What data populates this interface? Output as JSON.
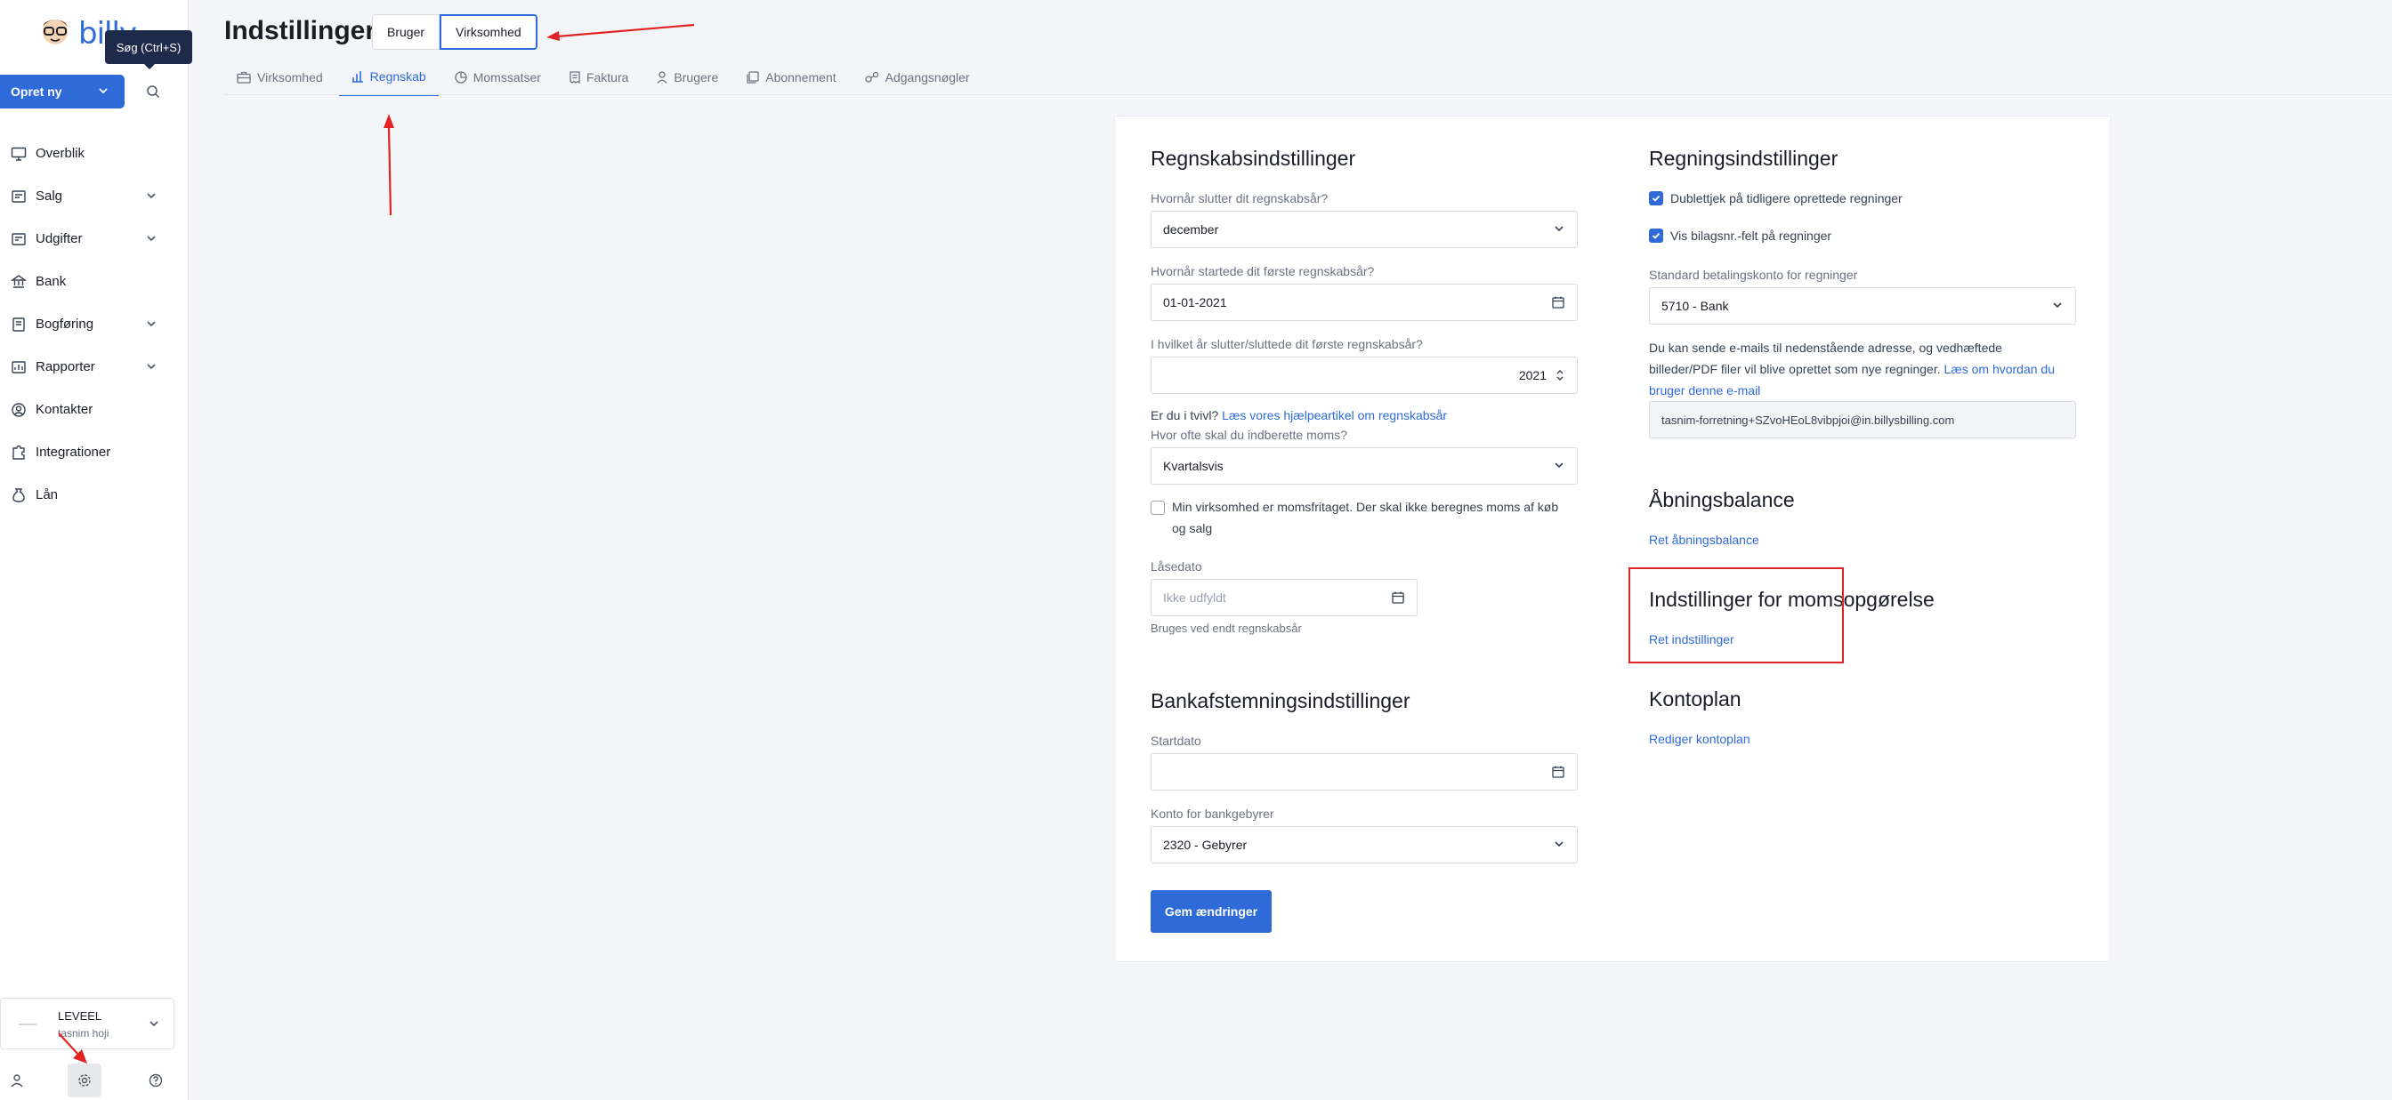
{
  "app": {
    "logo_text": "billy"
  },
  "tooltip": {
    "text": "Søg (Ctrl+S)"
  },
  "sidebar": {
    "create_label": "Opret ny",
    "items": [
      {
        "label": "Overblik",
        "icon": "monitor-icon",
        "expandable": false
      },
      {
        "label": "Salg",
        "icon": "receipt-icon",
        "expandable": true
      },
      {
        "label": "Udgifter",
        "icon": "wallet-icon",
        "expandable": true
      },
      {
        "label": "Bank",
        "icon": "bank-icon",
        "expandable": false
      },
      {
        "label": "Bogføring",
        "icon": "book-icon",
        "expandable": true
      },
      {
        "label": "Rapporter",
        "icon": "report-icon",
        "expandable": true
      },
      {
        "label": "Kontakter",
        "icon": "contact-icon",
        "expandable": false
      },
      {
        "label": "Integrationer",
        "icon": "puzzle-icon",
        "expandable": false
      },
      {
        "label": "Lån",
        "icon": "money-bag-icon",
        "expandable": false
      }
    ],
    "org": {
      "name": "LEVEEL",
      "user": "tasnim hoji"
    }
  },
  "header": {
    "title": "Indstillinger",
    "segments": [
      "Bruger",
      "Virksomhed"
    ],
    "active_segment": "Virksomhed",
    "tabs": [
      {
        "label": "Virksomhed",
        "icon": "briefcase-icon"
      },
      {
        "label": "Regnskab",
        "icon": "bar-chart-icon"
      },
      {
        "label": "Momssatser",
        "icon": "pie-chart-icon"
      },
      {
        "label": "Faktura",
        "icon": "invoice-icon"
      },
      {
        "label": "Brugere",
        "icon": "user-icon"
      },
      {
        "label": "Abonnement",
        "icon": "subscription-icon"
      },
      {
        "label": "Adgangsnøgler",
        "icon": "key-icon"
      }
    ],
    "active_tab": "Regnskab"
  },
  "accounting": {
    "title": "Regnskabsindstillinger",
    "fy_end_label": "Hvornår slutter dit regnskabsår?",
    "fy_end_value": "december",
    "first_fy_start_label": "Hvornår startede dit første regnskabsår?",
    "first_fy_start_value": "01-01-2021",
    "first_fy_end_year_label": "I hvilket år slutter/sluttede dit første regnskabsår?",
    "first_fy_end_year_value": "2021",
    "doubt_text": "Er du i tvivl?",
    "doubt_link": "Læs vores hjælpeartikel om regnskabsår",
    "vat_freq_label": "Hvor ofte skal du indberette moms?",
    "vat_freq_value": "Kvartalsvis",
    "vat_exempt_line1": "Min virksomhed er momsfritaget. Der skal ikke beregnes moms af køb",
    "vat_exempt_line2": "og salg",
    "lock_date_label": "Låsedato",
    "lock_date_placeholder": "Ikke udfyldt",
    "lock_date_hint": "Bruges ved endt regnskabsår"
  },
  "bank_reconciliation": {
    "title": "Bankafstemningsindstillinger",
    "start_date_label": "Startdato",
    "start_date_value": "",
    "fee_account_label": "Konto for bankgebyrer",
    "fee_account_value": "2320 - Gebyrer"
  },
  "save_label": "Gem ændringer",
  "bills": {
    "title": "Regningsindstillinger",
    "duplicate_check_label": "Dublettjek på tidligere oprettede regninger",
    "duplicate_check_checked": true,
    "show_voucher_label": "Vis bilagsnr.-felt på regninger",
    "show_voucher_checked": true,
    "payment_account_label": "Standard betalingskonto for regninger",
    "payment_account_value": "5710 - Bank",
    "email_text_line1": "Du kan sende e-mails til nedenstående adresse, og vedhæftede",
    "email_text_line2": "billeder/PDF filer vil blive oprettet som nye regninger.",
    "email_link_part1": "Læs om hvordan du",
    "email_link_part2": "bruger denne e-mail",
    "email_address": "tasnim-forretning+SZvoHEoL8vibpjoi@in.billysbilling.com"
  },
  "opening_balance": {
    "title": "Åbningsbalance",
    "link": "Ret åbningsbalance"
  },
  "vat_settlement": {
    "title": "Indstillinger for momsopgørelse",
    "link": "Ret indstillinger"
  },
  "chart_of_accounts": {
    "title": "Kontoplan",
    "link": "Rediger kontoplan"
  },
  "colors": {
    "primary": "#2f6ad9",
    "annotation": "#e02424"
  }
}
